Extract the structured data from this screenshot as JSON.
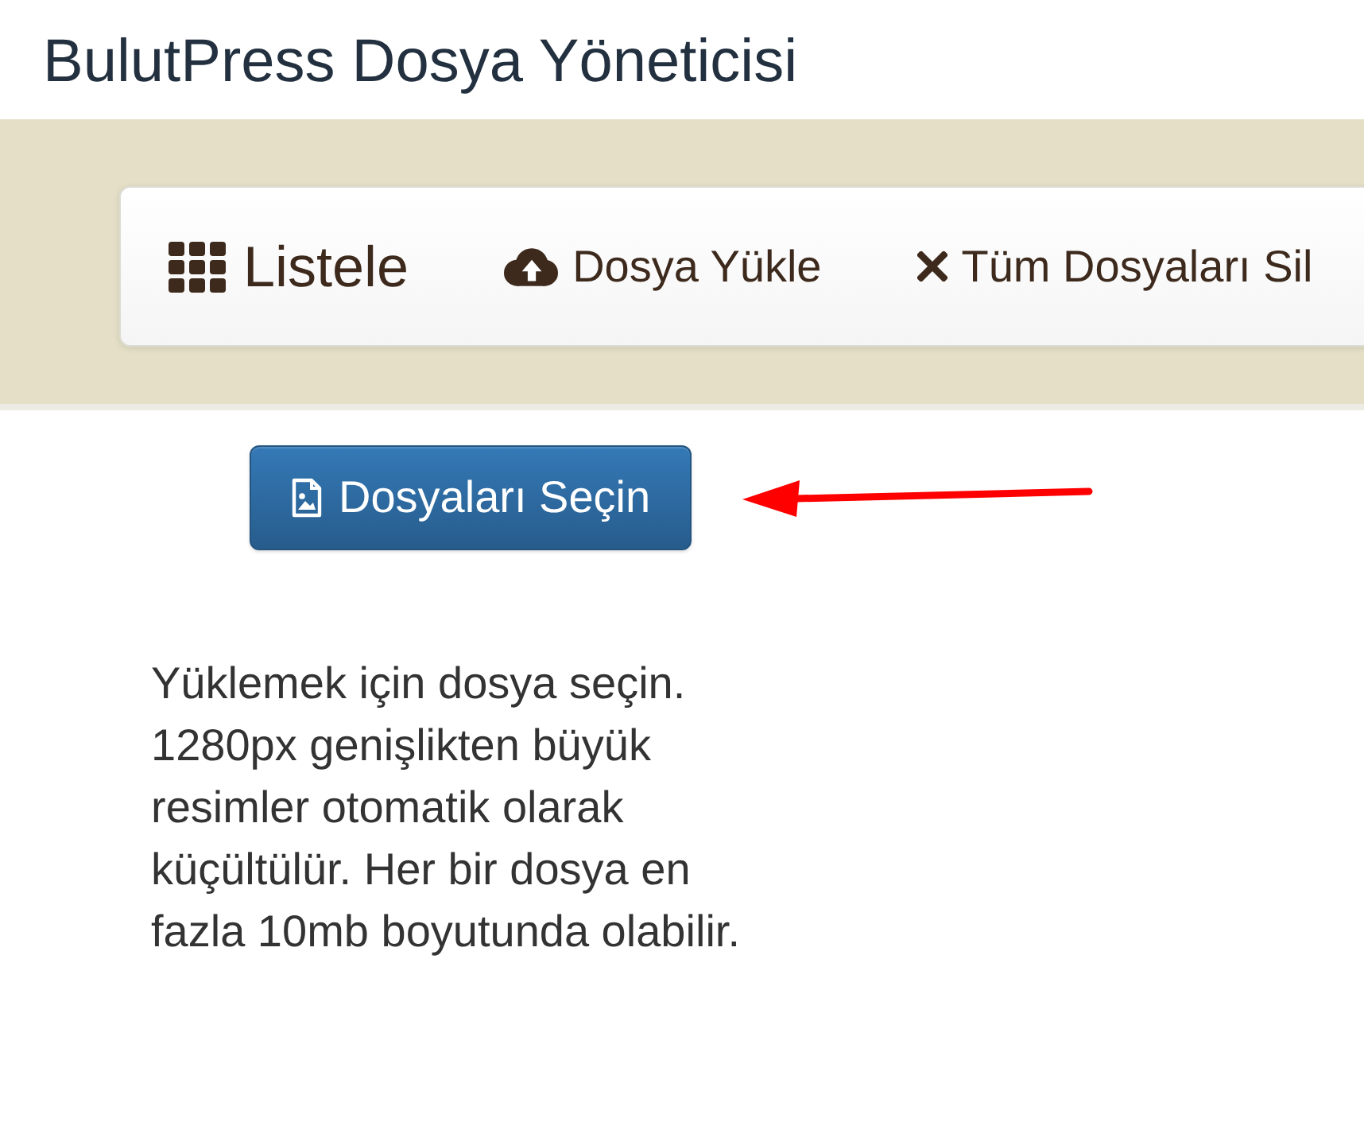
{
  "title": "BulutPress Dosya Yöneticisi",
  "nav": {
    "brand": {
      "label": "Listele"
    },
    "items": [
      {
        "label": "Dosya Yükle"
      },
      {
        "label": "Tüm Dosyaları Sil"
      }
    ]
  },
  "upload": {
    "button": "Dosyaları Seçin",
    "help_text": "Yüklemek için dosya seçin. 1280px genişlikten büyük resimler otomatik olarak küçültülür. Her bir dosya en fazla 10mb boyutunda olabilir."
  }
}
